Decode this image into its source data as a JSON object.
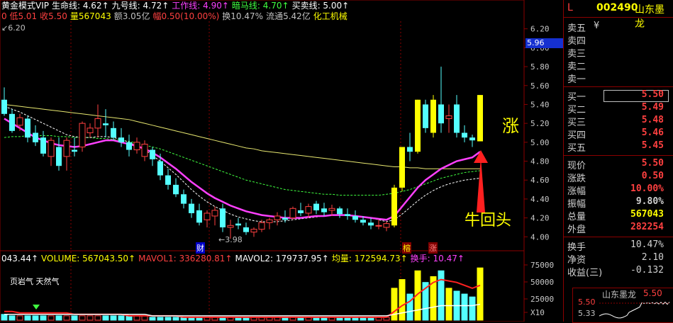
{
  "header": {
    "line1": [
      {
        "text": "黄金模式VIP",
        "color": "#ffffff"
      },
      {
        "text": "生命线: 4.62↑",
        "color": "#ffffff"
      },
      {
        "text": "九号线: 4.72↑",
        "color": "#ffffff"
      },
      {
        "text": "工作线: 4.90↑",
        "color": "#ff40ff"
      },
      {
        "text": "暗马线: 4.70↑",
        "color": "#40ff40"
      },
      {
        "text": "买卖线: 5.00↑",
        "color": "#ffffff"
      }
    ],
    "line2": [
      {
        "text": "0 低5.01",
        "color": "#ff4040"
      },
      {
        "text": "收5.50",
        "color": "#ff4040"
      },
      {
        "text": "量567043",
        "color": "#ffff00"
      },
      {
        "text": "额3.05亿",
        "color": "#c0c0c0"
      },
      {
        "text": "幅0.50(10.00%)",
        "color": "#ff4040"
      },
      {
        "text": "换10.47%",
        "color": "#c0c0c0"
      },
      {
        "text": "流通5.42亿",
        "color": "#c0c0c0"
      },
      {
        "text": "化工机械",
        "color": "#ffff00"
      }
    ],
    "max_label": "6.20",
    "min_label": "3.98"
  },
  "price_axis": [
    "6.20",
    "6.00",
    "5.80",
    "5.60",
    "5.40",
    "5.20",
    "5.00",
    "4.80",
    "4.60",
    "4.40",
    "4.20",
    "4.00"
  ],
  "current_price_tag": "5.96",
  "annotations": {
    "zhang": "涨",
    "niu": "牛回头",
    "cai": "财",
    "rong": "榕",
    "zhang2": "涨"
  },
  "volume_header": [
    {
      "text": "043.44↑",
      "color": "#ffffff"
    },
    {
      "text": "VOLUME: 567043.50↑",
      "color": "#ffff00"
    },
    {
      "text": "MAVOL1: 336280.81↑",
      "color": "#ff4040"
    },
    {
      "text": "MAVOL2: 179737.95↑",
      "color": "#ffffff"
    },
    {
      "text": "均量: 172594.73↑",
      "color": "#ffff00"
    },
    {
      "text": "换手: 10.47↑",
      "color": "#ff40ff"
    }
  ],
  "volume_axis": [
    "75000",
    "50000",
    "25000",
    "X10"
  ],
  "concept_text": "页岩气 天然气",
  "quote": {
    "prefix": "L",
    "code": "002490",
    "name": "山东墨龙",
    "sell": [
      {
        "label": "卖五",
        "price": "¥"
      },
      {
        "label": "卖四",
        "price": ""
      },
      {
        "label": "卖三",
        "price": ""
      },
      {
        "label": "卖二",
        "price": ""
      },
      {
        "label": "卖一",
        "price": ""
      }
    ],
    "buy": [
      {
        "label": "买一",
        "price": "5.50"
      },
      {
        "label": "买二",
        "price": "5.49"
      },
      {
        "label": "买三",
        "price": "5.48"
      },
      {
        "label": "买四",
        "price": "5.46"
      },
      {
        "label": "买五",
        "price": "5.45"
      }
    ],
    "stats": [
      {
        "label": "现价",
        "value": "5.50",
        "color": "#ff4040"
      },
      {
        "label": "涨跌",
        "value": "0.50",
        "color": "#ff4040"
      },
      {
        "label": "涨幅",
        "value": "10.00%",
        "color": "#ff4040"
      },
      {
        "label": "振幅",
        "value": "9.80%",
        "color": "#d0d0d0"
      },
      {
        "label": "总量",
        "value": "567043",
        "color": "#ffff00"
      },
      {
        "label": "外盘",
        "value": "282254",
        "color": "#ff4040"
      }
    ],
    "stats2": [
      {
        "label": "换手",
        "value": "10.47%",
        "color": "#d0d0d0"
      },
      {
        "label": "净资",
        "value": "2.10",
        "color": "#d0d0d0"
      },
      {
        "label": "收益(三)",
        "value": "-0.132",
        "color": "#d0d0d0"
      }
    ],
    "mini_title": "山东墨龙",
    "mini_price": "5.50",
    "mini_sub": "5.50",
    "mini_low": "5.33"
  },
  "chart_data": {
    "type": "candlestick",
    "ylim": [
      3.92,
      6.28
    ],
    "candles": [
      {
        "o": 5.45,
        "h": 5.58,
        "l": 5.28,
        "c": 5.3
      },
      {
        "o": 5.3,
        "h": 5.35,
        "l": 5.1,
        "c": 5.12
      },
      {
        "o": 5.18,
        "h": 5.3,
        "l": 5.12,
        "c": 5.26
      },
      {
        "o": 5.25,
        "h": 5.28,
        "l": 5.0,
        "c": 5.05
      },
      {
        "o": 5.1,
        "h": 5.18,
        "l": 4.96,
        "c": 5.0
      },
      {
        "o": 5.05,
        "h": 5.12,
        "l": 4.85,
        "c": 4.88
      },
      {
        "o": 4.85,
        "h": 5.05,
        "l": 4.75,
        "c": 5.02
      },
      {
        "o": 4.95,
        "h": 5.05,
        "l": 4.7,
        "c": 4.75
      },
      {
        "o": 4.85,
        "h": 5.05,
        "l": 4.7,
        "c": 5.02
      },
      {
        "o": 4.92,
        "h": 5.05,
        "l": 4.85,
        "c": 4.9
      },
      {
        "o": 4.95,
        "h": 5.22,
        "l": 4.9,
        "c": 5.2
      },
      {
        "o": 5.1,
        "h": 5.2,
        "l": 5.05,
        "c": 5.15
      },
      {
        "o": 5.15,
        "h": 5.4,
        "l": 5.05,
        "c": 5.25
      },
      {
        "o": 5.2,
        "h": 5.35,
        "l": 5.05,
        "c": 5.18
      },
      {
        "o": 5.15,
        "h": 5.22,
        "l": 5.02,
        "c": 5.05
      },
      {
        "o": 5.05,
        "h": 5.15,
        "l": 4.95,
        "c": 5.0
      },
      {
        "o": 5.0,
        "h": 5.08,
        "l": 4.85,
        "c": 4.92
      },
      {
        "o": 4.92,
        "h": 5.05,
        "l": 4.88,
        "c": 5.0
      },
      {
        "o": 4.85,
        "h": 5.02,
        "l": 4.8,
        "c": 4.98
      },
      {
        "o": 4.92,
        "h": 4.95,
        "l": 4.75,
        "c": 4.82
      },
      {
        "o": 4.8,
        "h": 4.88,
        "l": 4.6,
        "c": 4.65
      },
      {
        "o": 4.65,
        "h": 4.72,
        "l": 4.5,
        "c": 4.55
      },
      {
        "o": 4.55,
        "h": 4.62,
        "l": 4.42,
        "c": 4.45
      },
      {
        "o": 4.45,
        "h": 4.5,
        "l": 4.3,
        "c": 4.35
      },
      {
        "o": 4.35,
        "h": 4.4,
        "l": 4.2,
        "c": 4.25
      },
      {
        "o": 4.28,
        "h": 4.35,
        "l": 4.12,
        "c": 4.15
      },
      {
        "o": 4.18,
        "h": 4.28,
        "l": 4.1,
        "c": 4.25
      },
      {
        "o": 4.22,
        "h": 4.32,
        "l": 4.12,
        "c": 4.28
      },
      {
        "o": 4.3,
        "h": 4.35,
        "l": 4.05,
        "c": 4.1
      },
      {
        "o": 4.1,
        "h": 4.18,
        "l": 3.98,
        "c": 4.12
      },
      {
        "o": 4.14,
        "h": 4.2,
        "l": 4.08,
        "c": 4.12
      },
      {
        "o": 4.1,
        "h": 4.15,
        "l": 4.02,
        "c": 4.05
      },
      {
        "o": 4.05,
        "h": 4.1,
        "l": 4.0,
        "c": 4.08
      },
      {
        "o": 4.08,
        "h": 4.18,
        "l": 4.05,
        "c": 4.15
      },
      {
        "o": 4.15,
        "h": 4.2,
        "l": 4.08,
        "c": 4.18
      },
      {
        "o": 4.18,
        "h": 4.26,
        "l": 4.12,
        "c": 4.22
      },
      {
        "o": 4.2,
        "h": 4.28,
        "l": 4.15,
        "c": 4.18
      },
      {
        "o": 4.2,
        "h": 4.32,
        "l": 4.18,
        "c": 4.3
      },
      {
        "o": 4.28,
        "h": 4.36,
        "l": 4.22,
        "c": 4.25
      },
      {
        "o": 4.25,
        "h": 4.35,
        "l": 4.2,
        "c": 4.32
      },
      {
        "o": 4.35,
        "h": 4.38,
        "l": 4.24,
        "c": 4.28
      },
      {
        "o": 4.3,
        "h": 4.36,
        "l": 4.22,
        "c": 4.26
      },
      {
        "o": 4.28,
        "h": 4.34,
        "l": 4.22,
        "c": 4.3
      },
      {
        "o": 4.3,
        "h": 4.32,
        "l": 4.2,
        "c": 4.24
      },
      {
        "o": 4.24,
        "h": 4.3,
        "l": 4.18,
        "c": 4.22
      },
      {
        "o": 4.22,
        "h": 4.28,
        "l": 4.15,
        "c": 4.18
      },
      {
        "o": 4.18,
        "h": 4.22,
        "l": 4.12,
        "c": 4.15
      },
      {
        "o": 4.15,
        "h": 4.2,
        "l": 4.08,
        "c": 4.12
      },
      {
        "o": 4.12,
        "h": 4.18,
        "l": 4.08,
        "c": 4.12
      },
      {
        "o": 4.1,
        "h": 4.16,
        "l": 4.06,
        "c": 4.14
      },
      {
        "o": 4.12,
        "h": 4.55,
        "l": 4.1,
        "c": 4.52
      },
      {
        "o": 4.52,
        "h": 4.95,
        "l": 4.48,
        "c": 4.95
      },
      {
        "o": 4.95,
        "h": 5.1,
        "l": 4.8,
        "c": 4.9
      },
      {
        "o": 4.9,
        "h": 5.45,
        "l": 4.88,
        "c": 5.45
      },
      {
        "o": 5.4,
        "h": 5.45,
        "l": 5.1,
        "c": 5.15
      },
      {
        "o": 5.1,
        "h": 5.5,
        "l": 5.05,
        "c": 5.45
      },
      {
        "o": 5.4,
        "h": 5.8,
        "l": 5.1,
        "c": 5.2
      },
      {
        "o": 5.25,
        "h": 5.4,
        "l": 5.1,
        "c": 5.28
      },
      {
        "o": 5.4,
        "h": 5.5,
        "l": 5.05,
        "c": 5.1
      },
      {
        "o": 5.1,
        "h": 5.18,
        "l": 5.0,
        "c": 5.05
      },
      {
        "o": 5.05,
        "h": 5.08,
        "l": 4.95,
        "c": 5.02
      },
      {
        "o": 5.01,
        "h": 5.5,
        "l": 5.01,
        "c": 5.5
      }
    ],
    "ma_life": [
      5.4,
      5.39,
      5.38,
      5.37,
      5.36,
      5.35,
      5.34,
      5.33,
      5.32,
      5.31,
      5.3,
      5.29,
      5.28,
      5.27,
      5.26,
      5.25,
      5.24,
      5.22,
      5.2,
      5.18,
      5.16,
      5.14,
      5.12,
      5.1,
      5.08,
      5.06,
      5.04,
      5.02,
      5.0,
      4.98,
      4.96,
      4.94,
      4.93,
      4.91,
      4.9,
      4.89,
      4.88,
      4.87,
      4.86,
      4.85,
      4.84,
      4.83,
      4.82,
      4.81,
      4.8,
      4.79,
      4.78,
      4.77,
      4.76,
      4.75,
      4.74,
      4.74,
      4.73,
      4.73,
      4.72,
      4.72,
      4.72,
      4.72,
      4.72,
      4.72,
      4.72,
      4.72
    ],
    "ma_work": [
      5.25,
      5.2,
      5.15,
      5.1,
      5.05,
      5.02,
      4.99,
      4.97,
      4.96,
      4.95,
      4.96,
      4.98,
      5.0,
      5.02,
      5.02,
      5.0,
      4.98,
      4.96,
      4.93,
      4.89,
      4.84,
      4.78,
      4.72,
      4.65,
      4.58,
      4.52,
      4.46,
      4.41,
      4.37,
      4.33,
      4.3,
      4.27,
      4.25,
      4.23,
      4.22,
      4.21,
      4.2,
      4.2,
      4.2,
      4.21,
      4.22,
      4.22,
      4.23,
      4.23,
      4.23,
      4.22,
      4.21,
      4.2,
      4.19,
      4.18,
      4.22,
      4.32,
      4.42,
      4.52,
      4.6,
      4.66,
      4.72,
      4.76,
      4.8,
      4.82,
      4.84,
      4.9
    ],
    "ma_dark": [
      5.05,
      5.06,
      5.06,
      5.07,
      5.07,
      5.07,
      5.07,
      5.06,
      5.06,
      5.05,
      5.05,
      5.05,
      5.04,
      5.04,
      5.03,
      5.02,
      5.01,
      4.99,
      4.97,
      4.95,
      4.93,
      4.9,
      4.87,
      4.84,
      4.81,
      4.78,
      4.75,
      4.72,
      4.69,
      4.66,
      4.63,
      4.6,
      4.58,
      4.56,
      4.54,
      4.52,
      4.5,
      4.49,
      4.48,
      4.47,
      4.46,
      4.45,
      4.45,
      4.44,
      4.44,
      4.44,
      4.44,
      4.44,
      4.44,
      4.45,
      4.46,
      4.48,
      4.5,
      4.53,
      4.56,
      4.59,
      4.62,
      4.64,
      4.66,
      4.68,
      4.69,
      4.7
    ],
    "ma_nine": [
      5.38,
      5.35,
      5.32,
      5.28,
      5.24,
      5.2,
      5.16,
      5.12,
      5.08,
      5.06,
      5.05,
      5.05,
      5.06,
      5.06,
      5.05,
      5.03,
      5.0,
      4.96,
      4.92,
      4.86,
      4.8,
      4.73,
      4.66,
      4.58,
      4.5,
      4.43,
      4.37,
      4.32,
      4.28,
      4.24,
      4.21,
      4.19,
      4.17,
      4.16,
      4.16,
      4.16,
      4.17,
      4.18,
      4.19,
      4.2,
      4.21,
      4.22,
      4.23,
      4.23,
      4.23,
      4.22,
      4.21,
      4.2,
      4.18,
      4.16,
      4.18,
      4.24,
      4.31,
      4.38,
      4.44,
      4.49,
      4.53,
      4.56,
      4.58,
      4.6,
      4.61,
      4.62
    ],
    "volume": [
      4,
      3,
      3,
      3,
      3,
      3,
      3,
      3,
      3,
      3,
      3,
      3,
      3,
      3,
      3,
      3,
      3,
      3,
      3,
      2,
      2,
      2,
      2,
      2,
      2,
      2,
      2,
      2,
      2,
      2,
      2,
      2,
      2,
      2,
      2,
      2,
      2,
      2,
      2,
      2,
      2,
      2,
      2,
      2,
      2,
      2,
      2,
      2,
      2,
      2,
      22,
      28,
      18,
      34,
      26,
      30,
      34,
      22,
      20,
      18,
      16,
      36
    ],
    "mavol1": [
      6,
      6,
      5,
      5,
      5,
      5,
      5,
      5,
      5,
      4,
      4,
      4,
      4,
      4,
      4,
      4,
      3,
      3,
      3,
      3,
      3,
      3,
      3,
      2,
      2,
      2,
      2,
      2,
      2,
      2,
      2,
      2,
      2,
      2,
      2,
      2,
      2,
      2,
      2,
      2,
      2,
      2,
      2,
      2,
      2,
      2,
      2,
      2,
      2,
      2,
      6,
      10,
      13,
      18,
      22,
      26,
      28,
      27,
      26,
      24,
      22,
      24
    ],
    "mavol2": [
      4,
      4,
      4,
      4,
      4,
      4,
      4,
      4,
      4,
      4,
      4,
      4,
      4,
      4,
      4,
      4,
      4,
      4,
      4,
      3,
      3,
      3,
      3,
      3,
      3,
      3,
      3,
      3,
      3,
      3,
      3,
      3,
      3,
      3,
      3,
      3,
      3,
      3,
      3,
      3,
      3,
      3,
      3,
      3,
      3,
      3,
      3,
      3,
      3,
      3,
      4,
      5,
      6,
      7,
      8,
      9,
      10,
      10,
      10,
      10,
      10,
      11
    ]
  }
}
